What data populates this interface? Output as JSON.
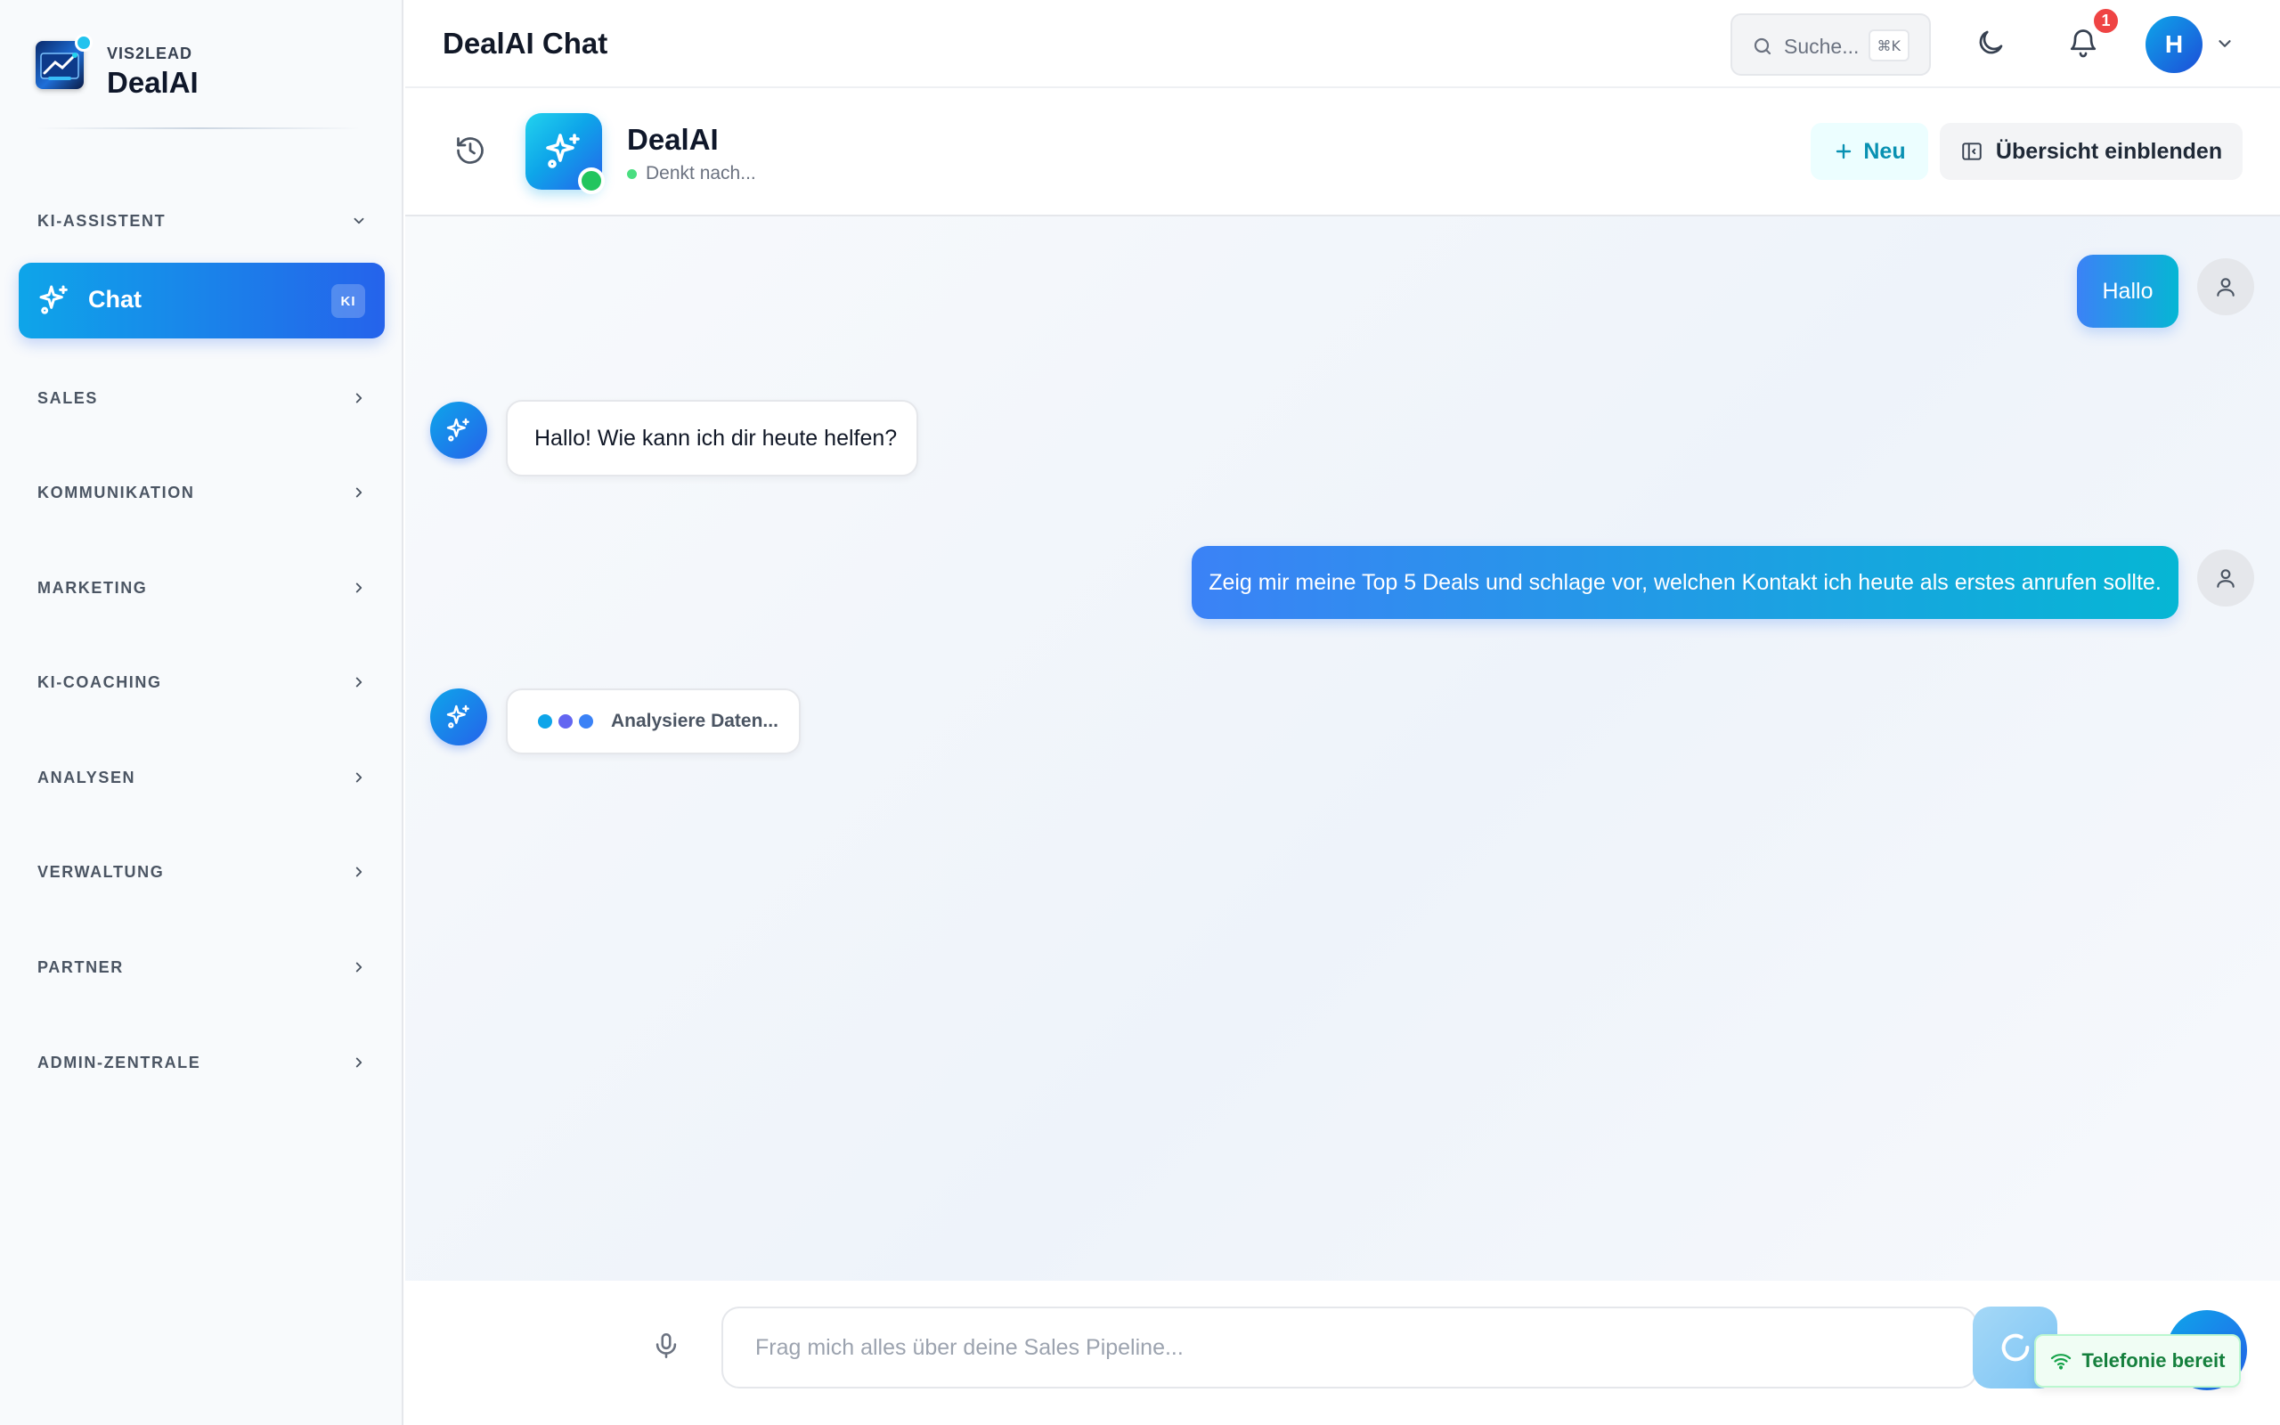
{
  "colors": {
    "accent": "#2563eb",
    "accent_cyan": "#0ea5e9",
    "online": "#22c55e",
    "notification": "#ef4444"
  },
  "sidebar": {
    "brand_sub": "VIS2LEAD",
    "brand_title": "DealAI",
    "sections": [
      {
        "label": "KI-ASSISTENT",
        "expanded": true
      },
      {
        "label": "SALES",
        "expanded": false
      },
      {
        "label": "KOMMUNIKATION",
        "expanded": false
      },
      {
        "label": "MARKETING",
        "expanded": false
      },
      {
        "label": "KI-COACHING",
        "expanded": false
      },
      {
        "label": "ANALYSEN",
        "expanded": false
      },
      {
        "label": "VERWALTUNG",
        "expanded": false
      },
      {
        "label": "PARTNER",
        "expanded": false
      },
      {
        "label": "ADMIN-ZENTRALE",
        "expanded": false
      }
    ],
    "active_item": {
      "label": "Chat",
      "badge": "KI",
      "icon": "sparkles-icon"
    }
  },
  "topbar": {
    "title": "DealAI Chat",
    "search_placeholder": "Suche...",
    "search_shortcut": "⌘K",
    "notification_count": "1",
    "avatar_initial": "H"
  },
  "chat_header": {
    "bot_name": "DealAI",
    "status": "Denkt nach...",
    "new_label": "Neu",
    "overview_label": "Übersicht einblenden"
  },
  "messages": [
    {
      "role": "user",
      "text": "Hallo"
    },
    {
      "role": "bot",
      "text": "Hallo! Wie kann ich dir heute helfen?"
    },
    {
      "role": "user",
      "text": "Zeig mir meine Top 5 Deals und schlage vor, welchen Kontakt ich heute als erstes anrufen sollte."
    },
    {
      "role": "bot",
      "text": "Analysiere Daten...",
      "typing": true
    }
  ],
  "composer": {
    "placeholder": "Frag mich alles über deine Sales Pipeline...",
    "value": "",
    "telephony_status": "Telefonie bereit"
  }
}
